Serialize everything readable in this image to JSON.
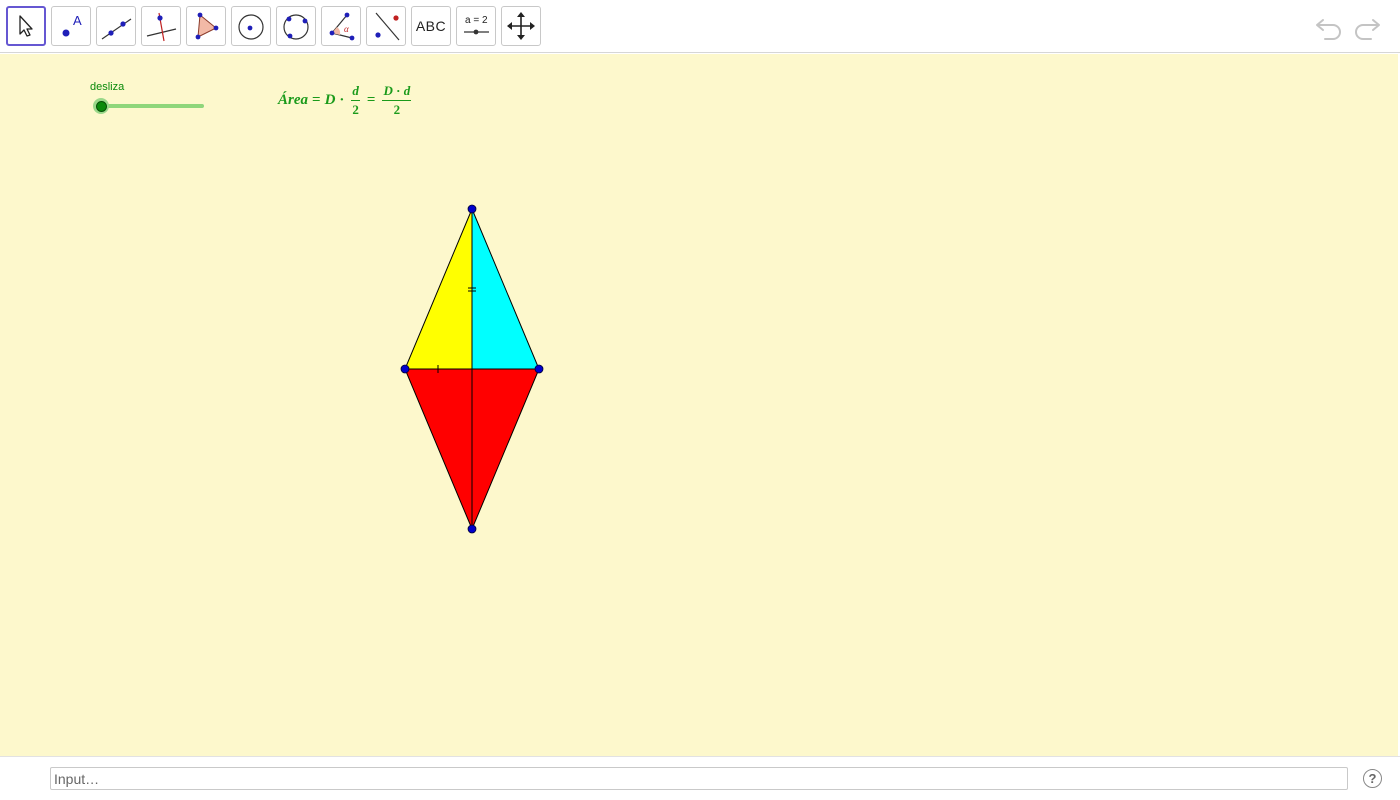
{
  "toolbar": {
    "tools": [
      {
        "name": "move-tool",
        "icon": "cursor-arrow-icon",
        "active": true
      },
      {
        "name": "point-tool",
        "icon": "point-icon"
      },
      {
        "name": "line-tool",
        "icon": "line-through-points-icon"
      },
      {
        "name": "perpendicular-line-tool",
        "icon": "perpendicular-line-icon"
      },
      {
        "name": "polygon-tool",
        "icon": "polygon-icon"
      },
      {
        "name": "circle-tool",
        "icon": "circle-center-point-icon"
      },
      {
        "name": "circle-three-points-tool",
        "icon": "circle-three-points-icon"
      },
      {
        "name": "angle-tool",
        "icon": "angle-icon"
      },
      {
        "name": "reflect-tool",
        "icon": "reflect-about-line-icon"
      },
      {
        "name": "text-tool",
        "icon": "text-icon",
        "label": "ABC"
      },
      {
        "name": "slider-tool",
        "icon": "slider-icon",
        "label": "a = 2"
      },
      {
        "name": "move-graphics-view-tool",
        "icon": "move-arrows-icon"
      }
    ],
    "undo_icon": "undo-icon",
    "redo_icon": "redo-icon"
  },
  "canvas": {
    "background": "#fdf8cc",
    "slider": {
      "label": "desliza",
      "value": 0,
      "color": "#0c8a0c",
      "track_color": "#8fd67a"
    },
    "formula": {
      "area_word": "Área",
      "equals": "=",
      "D": "D",
      "cdot": "·",
      "d": "d",
      "two": "2",
      "color": "#1a9a1a"
    },
    "figure": {
      "colors": {
        "left_top": "#ffff00",
        "right_top": "#00ffff",
        "bottom": "#ff0000",
        "vertex": "#0000cc"
      }
    }
  },
  "input": {
    "placeholder": "Input…"
  },
  "help": {
    "label": "?",
    "icon": "help-circle-icon"
  }
}
